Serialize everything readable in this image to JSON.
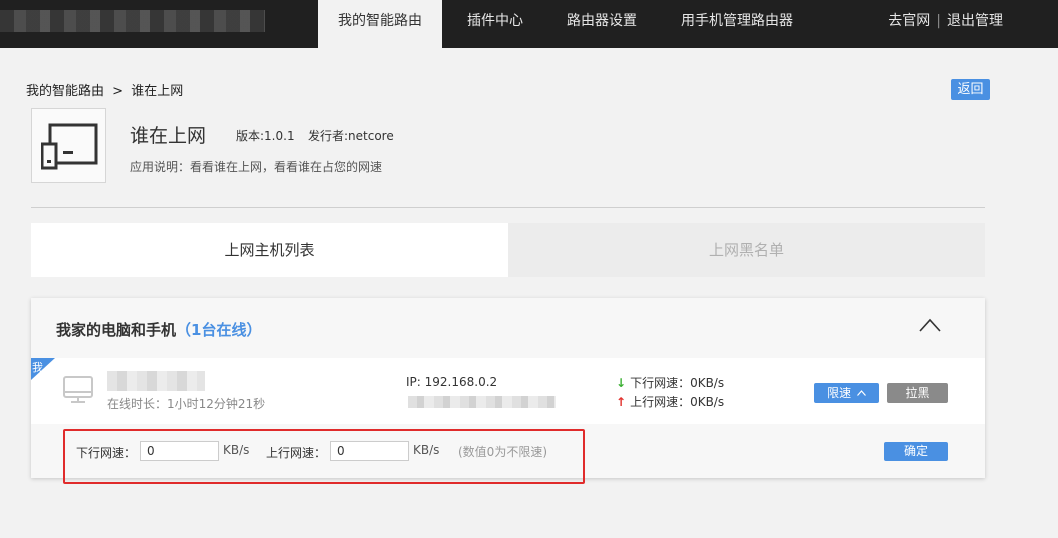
{
  "topbar": {
    "nav": [
      "我的智能路由",
      "插件中心",
      "路由器设置",
      "用手机管理路由器"
    ],
    "active_index": 0,
    "links": {
      "official": "去官网",
      "separator": "|",
      "logout": "退出管理"
    }
  },
  "breadcrumb": {
    "parent": "我的智能路由",
    "separator": ">",
    "current": "谁在上网"
  },
  "back_label": "返回",
  "app": {
    "name": "谁在上网",
    "version": "版本:1.0.1",
    "publisher": "发行者:netcore",
    "description": "应用说明：看看谁在上网，看看谁在占您的网速"
  },
  "subtabs": {
    "active": "上网主机列表",
    "inactive": "上网黑名单"
  },
  "panel": {
    "title": "我家的电脑和手机",
    "count": "（1台在线）",
    "device": {
      "badge": "我",
      "online_time": "在线时长：1小时12分钟21秒",
      "ip": "IP: 192.168.0.2",
      "down_speed": "下行网速：0KB/s",
      "up_speed": "上行网速：0KB/s",
      "limit_label": "限速",
      "block_label": "拉黑"
    },
    "limit_form": {
      "down_label": "下行网速：",
      "down_value": "0",
      "up_label": "上行网速：",
      "up_value": "0",
      "unit": "KB/s",
      "hint": "(数值0为不限速)",
      "confirm_label": "确定"
    }
  },
  "colors": {
    "accent": "#4a90e2",
    "topbar": "#202020",
    "highlight": "#e02b2b"
  }
}
